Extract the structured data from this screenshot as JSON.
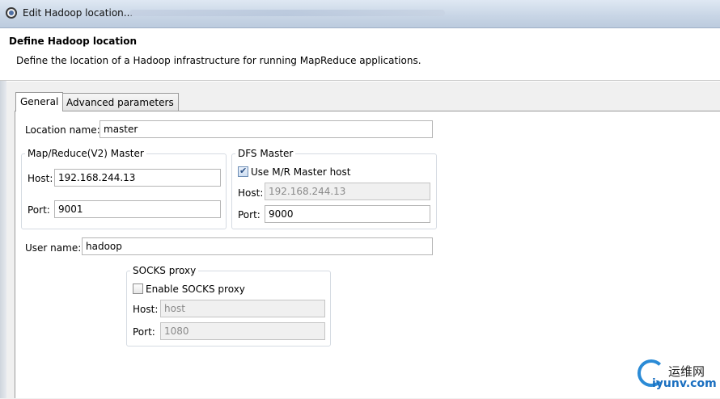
{
  "window": {
    "title": "Edit Hadoop location..."
  },
  "header": {
    "title": "Define Hadoop location",
    "description": "Define the location of a Hadoop infrastructure for running MapReduce applications."
  },
  "tabs": [
    {
      "label": "General",
      "selected": true
    },
    {
      "label": "Advanced parameters",
      "selected": false
    }
  ],
  "general": {
    "location_name_label": "Location name:",
    "location_name_value": "master",
    "mapreduce_master": {
      "title": "Map/Reduce(V2) Master",
      "host_label": "Host:",
      "host_value": "192.168.244.13",
      "port_label": "Port:",
      "port_value": "9001"
    },
    "dfs_master": {
      "title": "DFS Master",
      "use_mr_host_label": "Use M/R Master host",
      "use_mr_host_checked": true,
      "host_label": "Host:",
      "host_value": "192.168.244.13",
      "port_label": "Port:",
      "port_value": "9000"
    },
    "user_name_label": "User name:",
    "user_name_value": "hadoop",
    "socks_proxy": {
      "title": "SOCKS proxy",
      "enable_label": "Enable SOCKS proxy",
      "enable_checked": false,
      "host_label": "Host:",
      "host_value": "host",
      "port_label": "Port:",
      "port_value": "1080"
    }
  },
  "watermark": {
    "text_cn": "运维网",
    "url": "iyunv.com"
  },
  "colors": {
    "titlebar": "#c9d6e6",
    "panel_bg": "#ffffff",
    "dialog_bg": "#f0f0f0",
    "watermark_blue": "#2b8bd6"
  }
}
